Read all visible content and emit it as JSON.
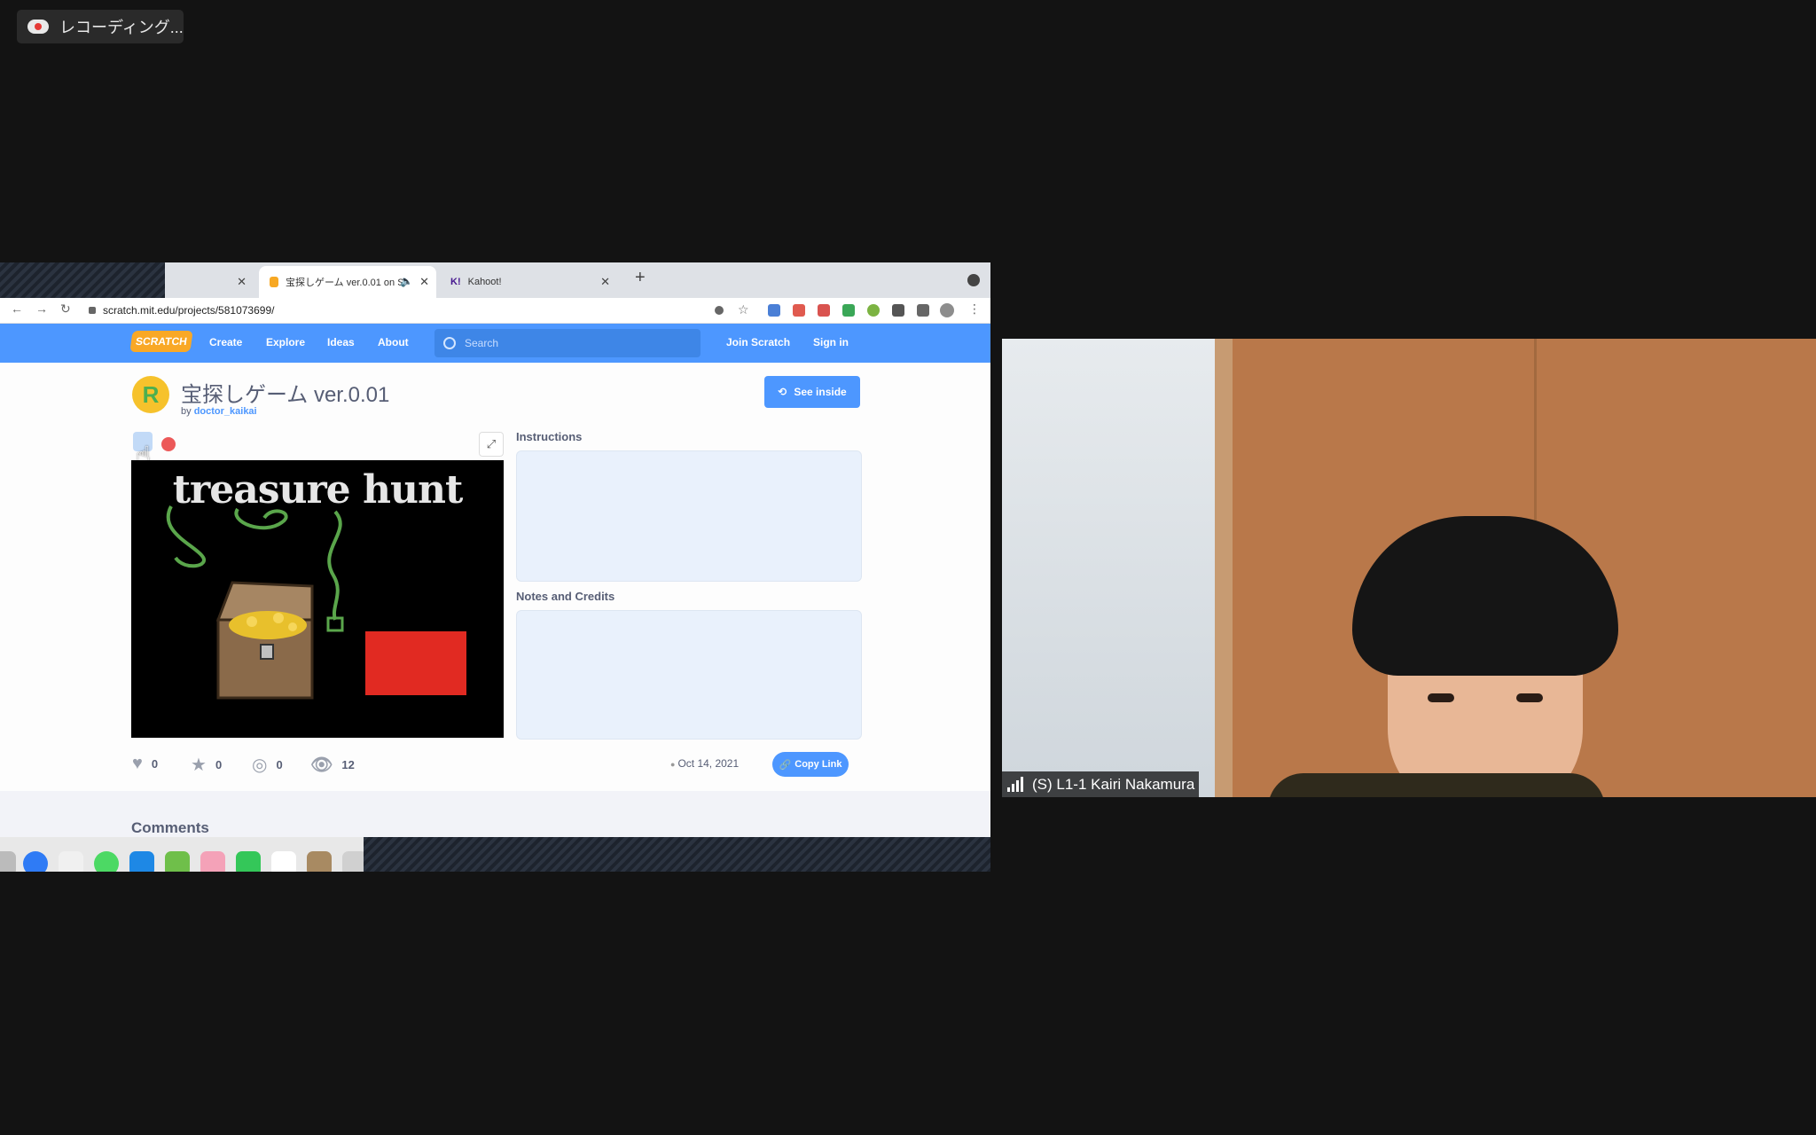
{
  "recording": {
    "label": "レコーディング..."
  },
  "browser": {
    "tabs": [
      {
        "title": ""
      },
      {
        "title": "宝探しゲーム ver.0.01 on S"
      },
      {
        "title": "Kahoot!"
      }
    ],
    "url": "scratch.mit.edu/projects/581073699/"
  },
  "scratch": {
    "logo": "SCRATCH",
    "nav": [
      "Create",
      "Explore",
      "Ideas",
      "About"
    ],
    "search_placeholder": "Search",
    "join": "Join Scratch",
    "signin": "Sign in",
    "avatar_letter": "R",
    "project_title": "宝探しゲーム ver.0.01",
    "by_prefix": "by",
    "author": "doctor_kaikai",
    "see_inside": "See inside",
    "stage_title": "treasure hunt",
    "instructions_label": "Instructions",
    "notes_label": "Notes and Credits",
    "stats": {
      "loves": "0",
      "favorites": "0",
      "remixes": "0",
      "views": "12"
    },
    "date": "Oct 14, 2021",
    "copy_link": "Copy Link",
    "comments_label": "Comments"
  },
  "video": {
    "participant_name": "(S) L1-1 Kairi Nakamura"
  },
  "colors": {
    "scratch_blue": "#4d97ff",
    "stop_red": "#ec5959",
    "background": "#131313"
  }
}
